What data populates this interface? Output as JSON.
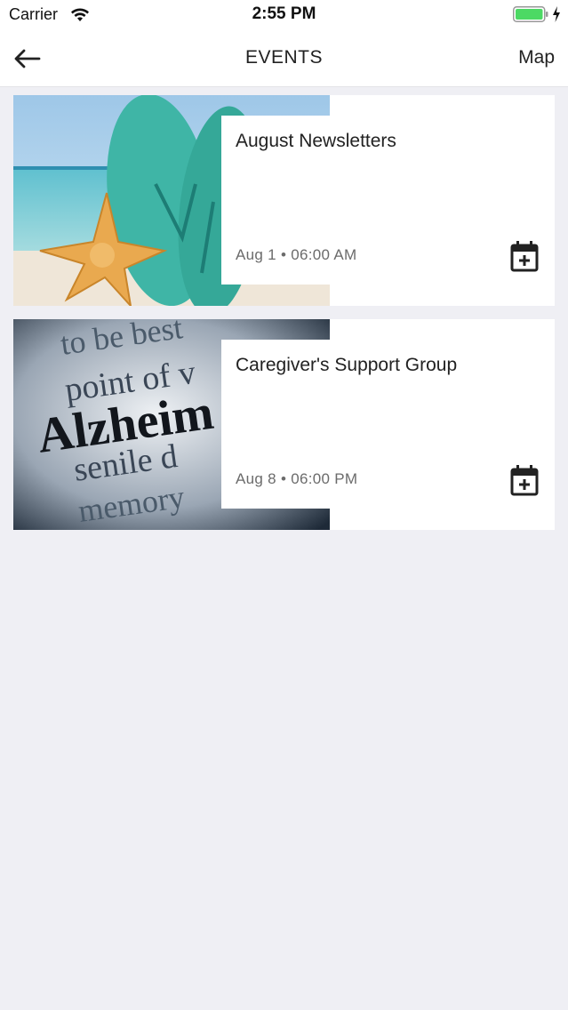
{
  "status_bar": {
    "carrier": "Carrier",
    "time": "2:55 PM",
    "battery_color": "#4cd964"
  },
  "nav": {
    "title": "EVENTS",
    "map_label": "Map",
    "back_icon": "arrow-left-icon"
  },
  "events": [
    {
      "title": "August Newsletters",
      "date": "Aug 1 • 06:00 AM",
      "image": "beach-starfish-flip-flops",
      "action_icon": "calendar-add-icon"
    },
    {
      "title": "Caregiver's Support Group",
      "date": "Aug 8 • 06:00 PM",
      "image": "alzheimers-dictionary-text",
      "action_icon": "calendar-add-icon"
    }
  ],
  "image_text": {
    "line1": "to be best",
    "line2": "point of v",
    "line3": "Alzheim",
    "line4": "senile d",
    "line5": "memory"
  }
}
